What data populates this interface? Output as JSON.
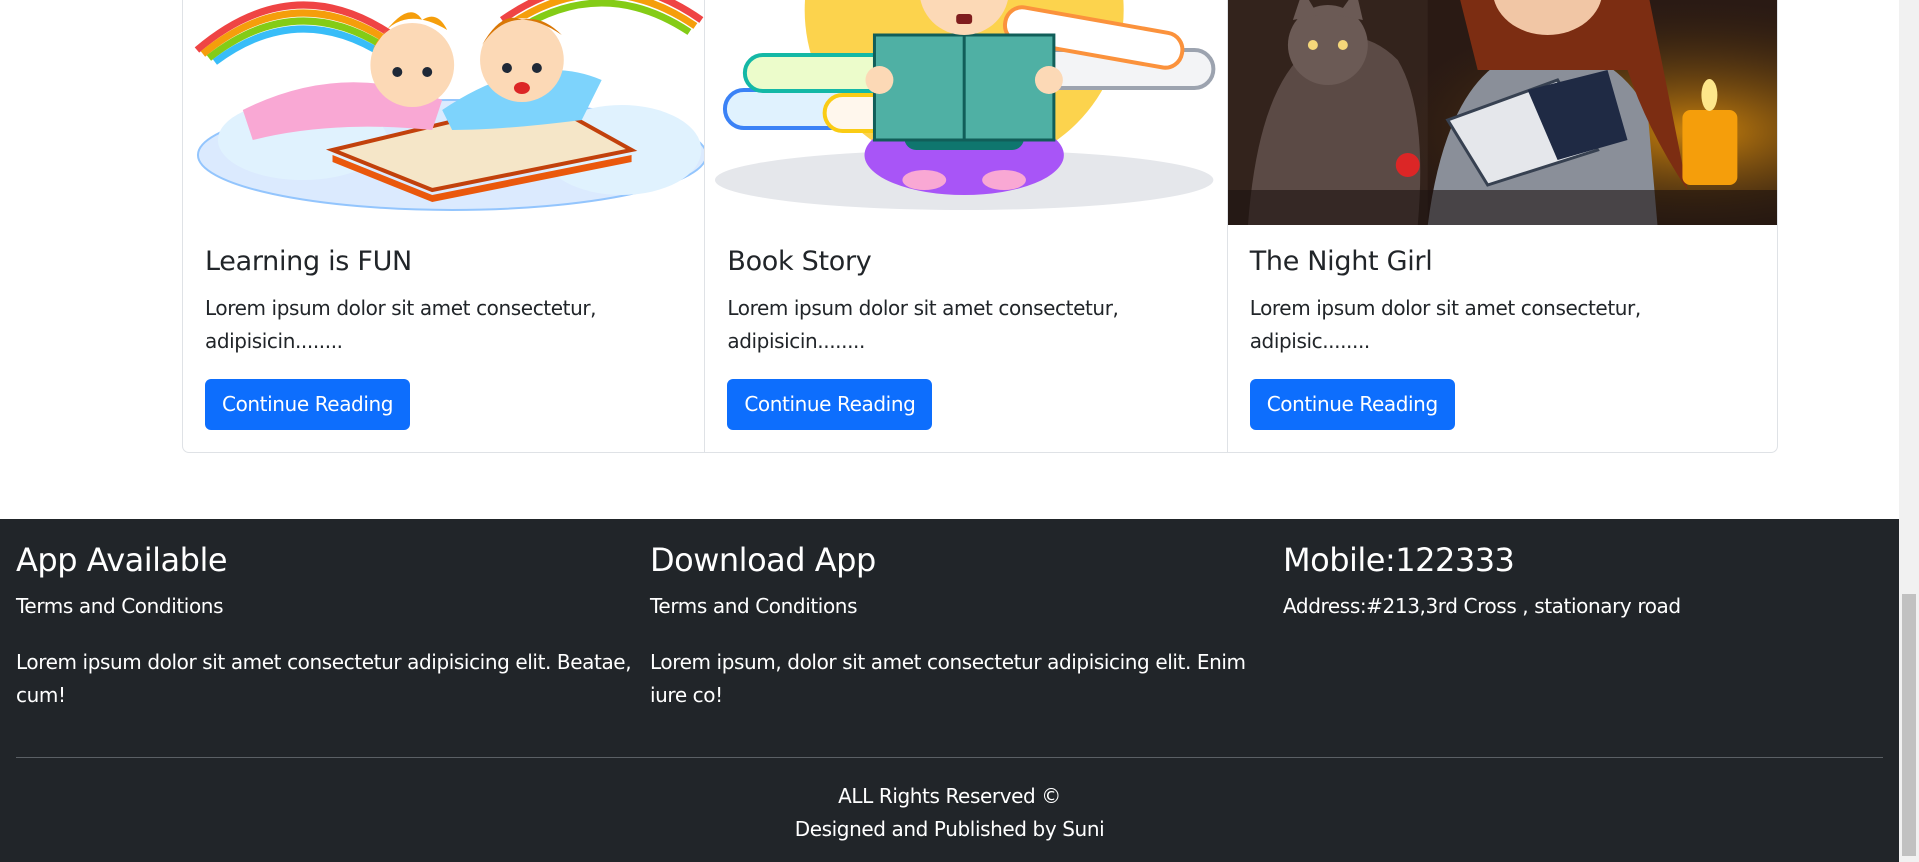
{
  "cards": [
    {
      "title": "Learning is FUN",
      "text": "Lorem ipsum dolor sit amet consectetur, adipisicin........",
      "button": "Continue Reading"
    },
    {
      "title": "Book Story",
      "text": "Lorem ipsum dolor sit amet consectetur, adipisicin........",
      "button": "Continue Reading"
    },
    {
      "title": "The Night Girl",
      "text": "Lorem ipsum dolor sit amet consectetur, adipisic........",
      "button": "Continue Reading"
    }
  ],
  "footer": {
    "col1": {
      "heading": "App Available",
      "link": "Terms and Conditions",
      "text": "Lorem ipsum dolor sit amet consectetur adipisicing elit. Beatae, cum!"
    },
    "col2": {
      "heading": "Download App",
      "link": "Terms and Conditions",
      "text": "Lorem ipsum, dolor sit amet consectetur adipisicing elit. Enim iure co!"
    },
    "col3": {
      "heading": "Mobile:122333",
      "address": "Address:#213,3rd Cross , stationary road"
    },
    "rights": "ALL Rights Reserved ©",
    "credit": "Designed and Published by Suni"
  },
  "colors": {
    "primary": "#0d6efd",
    "footer_bg": "#212529"
  }
}
